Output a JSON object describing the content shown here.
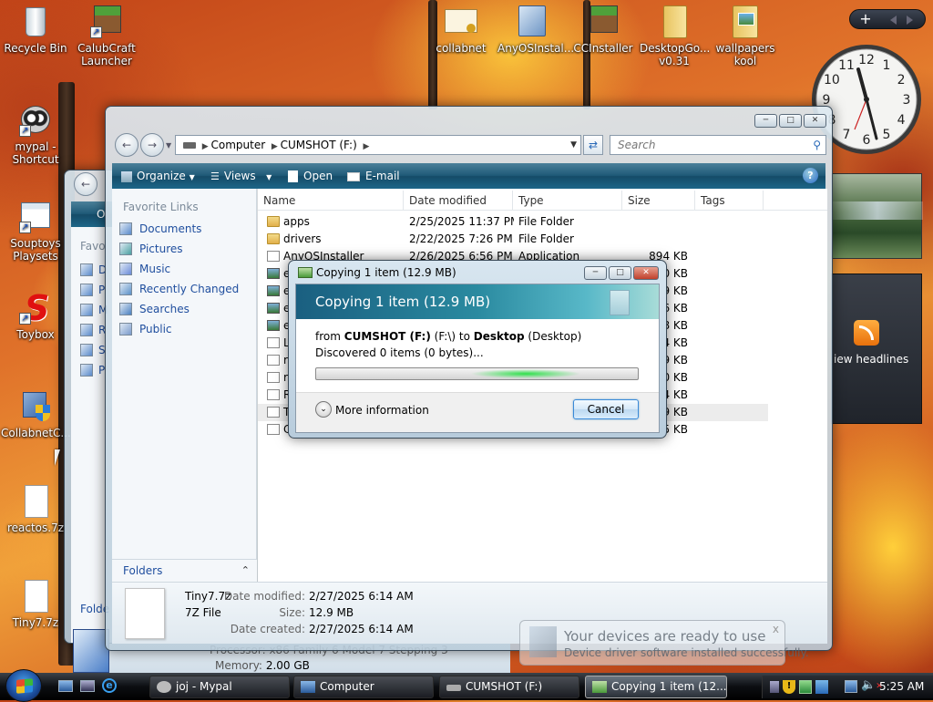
{
  "desktop": {
    "icons": [
      {
        "label": "Recycle Bin",
        "icon": "recycle-bin-icon"
      },
      {
        "label": "CalubCraft Launcher",
        "icon": "grass-block-icon"
      },
      {
        "label": "collabnet",
        "icon": "certificate-icon"
      },
      {
        "label": "AnyOSInstal...",
        "icon": "installer-icon"
      },
      {
        "label": "CCInstaller",
        "icon": "grass-block-icon"
      },
      {
        "label": "DesktopGo... v0.31",
        "icon": "folder-icon"
      },
      {
        "label": "wallpapers kool",
        "icon": "folder-icon"
      },
      {
        "label": "mypal - Shortcut",
        "icon": "raccoon-icon"
      },
      {
        "label": "Souptoys Playsets",
        "icon": "window-icon"
      },
      {
        "label": "Toybox",
        "icon": "s-logo-icon"
      },
      {
        "label": "CollabnetC...",
        "icon": "shield-setup-icon"
      },
      {
        "label": "reactos.7z",
        "icon": "file-icon"
      },
      {
        "label": "Tiny7.7z",
        "icon": "file-icon"
      }
    ]
  },
  "sidebar": {
    "add_symbol": "+",
    "clock_numbers": [
      "12",
      "1",
      "2",
      "3",
      "4",
      "5",
      "6",
      "7",
      "8",
      "9",
      "10",
      "11"
    ],
    "feed_text": "iew headlines"
  },
  "explorer": {
    "breadcrumb": [
      "Computer",
      "CUMSHOT (F:)"
    ],
    "search_placeholder": "Search",
    "toolbar": {
      "organize": "Organize",
      "views": "Views",
      "open": "Open",
      "email": "E-mail",
      "help": "?"
    },
    "favorite_links_title": "Favorite Links",
    "favorites": [
      "Documents",
      "Pictures",
      "Music",
      "Recently Changed",
      "Searches",
      "Public"
    ],
    "folders_label": "Folders",
    "columns": [
      "Name",
      "Date modified",
      "Type",
      "Size",
      "Tags"
    ],
    "files": [
      {
        "name": "apps",
        "date": "2/25/2025 11:37 PM",
        "type": "File Folder",
        "size": "",
        "icon": "folder"
      },
      {
        "name": "drivers",
        "date": "2/22/2025 7:26 PM",
        "type": "File Folder",
        "size": "",
        "icon": "folder"
      },
      {
        "name": "AnyOSInstaller",
        "date": "2/26/2025 6:56 PM",
        "type": "Application",
        "size": "894 KB",
        "icon": "file"
      },
      {
        "name": "e",
        "date": "",
        "type": "",
        "size": "0 KB",
        "icon": "img"
      },
      {
        "name": "e",
        "date": "",
        "type": "",
        "size": "9 KB",
        "icon": "img"
      },
      {
        "name": "e",
        "date": "",
        "type": "",
        "size": "6 KB",
        "icon": "img"
      },
      {
        "name": "e",
        "date": "",
        "type": "",
        "size": "8 KB",
        "icon": "img"
      },
      {
        "name": "L",
        "date": "",
        "type": "",
        "size": "4 KB",
        "icon": "file"
      },
      {
        "name": "ra",
        "date": "",
        "type": "",
        "size": "9 KB",
        "icon": "file"
      },
      {
        "name": "re",
        "date": "",
        "type": "",
        "size": "0 KB",
        "icon": "file"
      },
      {
        "name": "R",
        "date": "",
        "type": "",
        "size": "4 KB",
        "icon": "file"
      },
      {
        "name": "T",
        "date": "",
        "type": "",
        "size": "9 KB",
        "icon": "file"
      },
      {
        "name": "C",
        "date": "",
        "type": "",
        "size": "5 KB",
        "icon": "file"
      }
    ],
    "details": {
      "name": "Tiny7.7z",
      "type": "7Z File",
      "modified_label": "Date modified:",
      "modified": "2/27/2025 6:14 AM",
      "size_label": "Size:",
      "size": "12.9 MB",
      "created_label": "Date created:",
      "created": "2/27/2025 6:14 AM"
    }
  },
  "back_window": {
    "letters": [
      "D",
      "P",
      "M",
      "R",
      "S",
      "P"
    ],
    "favo": "Favo",
    "folde": "Folde",
    "processor": "Processor: x86 Family 6 Model 7 Stepping 3",
    "memory_label": "Memory:",
    "memory": "2.00 GB"
  },
  "copy_dialog": {
    "title": "Copying 1 item (12.9 MB)",
    "heading": "Copying 1 item (12.9 MB)",
    "from_word": "from",
    "source": "CUMSHOT (F:)",
    "source_path": "(F:\\)",
    "to_word": "to",
    "dest": "Desktop",
    "dest_path": "(Desktop)",
    "discovered": "Discovered 0 items (0 bytes)...",
    "more_info": "More information",
    "cancel": "Cancel",
    "progress_fraction": 0.0
  },
  "notification": {
    "title": "Your devices are ready to use",
    "body": "Device driver software installed successfully.",
    "close": "x"
  },
  "taskbar": {
    "tasks": [
      "joj - Mypal",
      "Computer",
      "CUMSHOT (F:)",
      "Copying 1 item (12..."
    ],
    "time": "5:25 AM"
  }
}
